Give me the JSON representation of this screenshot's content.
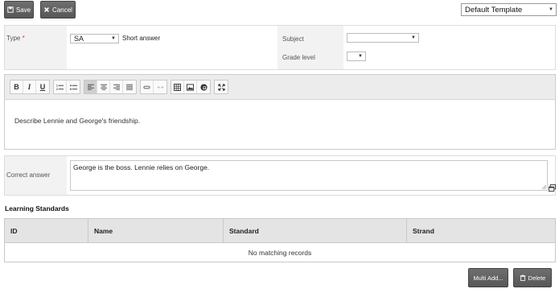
{
  "toolbar": {
    "save_label": "Save",
    "cancel_label": "Cancel",
    "template_value": "Default Template"
  },
  "form": {
    "type_label": "Type",
    "type_required": "*",
    "type_value": "SA",
    "type_description": "Short answer",
    "subject_label": "Subject",
    "subject_value": "",
    "grade_label": "Grade level",
    "grade_value": ""
  },
  "editor": {
    "tools": [
      "bold-icon",
      "italic-icon",
      "underline-icon",
      "ordered-list-icon",
      "unordered-list-icon",
      "align-left-icon",
      "align-center-icon",
      "align-right-icon",
      "align-justify-icon",
      "link-icon",
      "unlink-icon",
      "table-icon",
      "image-icon",
      "special-char-icon",
      "fullscreen-icon"
    ],
    "content": "Describe Lennie and George's friendship."
  },
  "correct_answer": {
    "label": "Correct answer",
    "value": "George is the boss.  Lennie relies on George."
  },
  "learning_standards": {
    "title": "Learning Standards",
    "columns": [
      "ID",
      "Name",
      "Standard",
      "Strand"
    ],
    "empty_message": "No matching records"
  },
  "actions": {
    "multi_add_label": "Multi Add...",
    "delete_label": "Delete"
  }
}
